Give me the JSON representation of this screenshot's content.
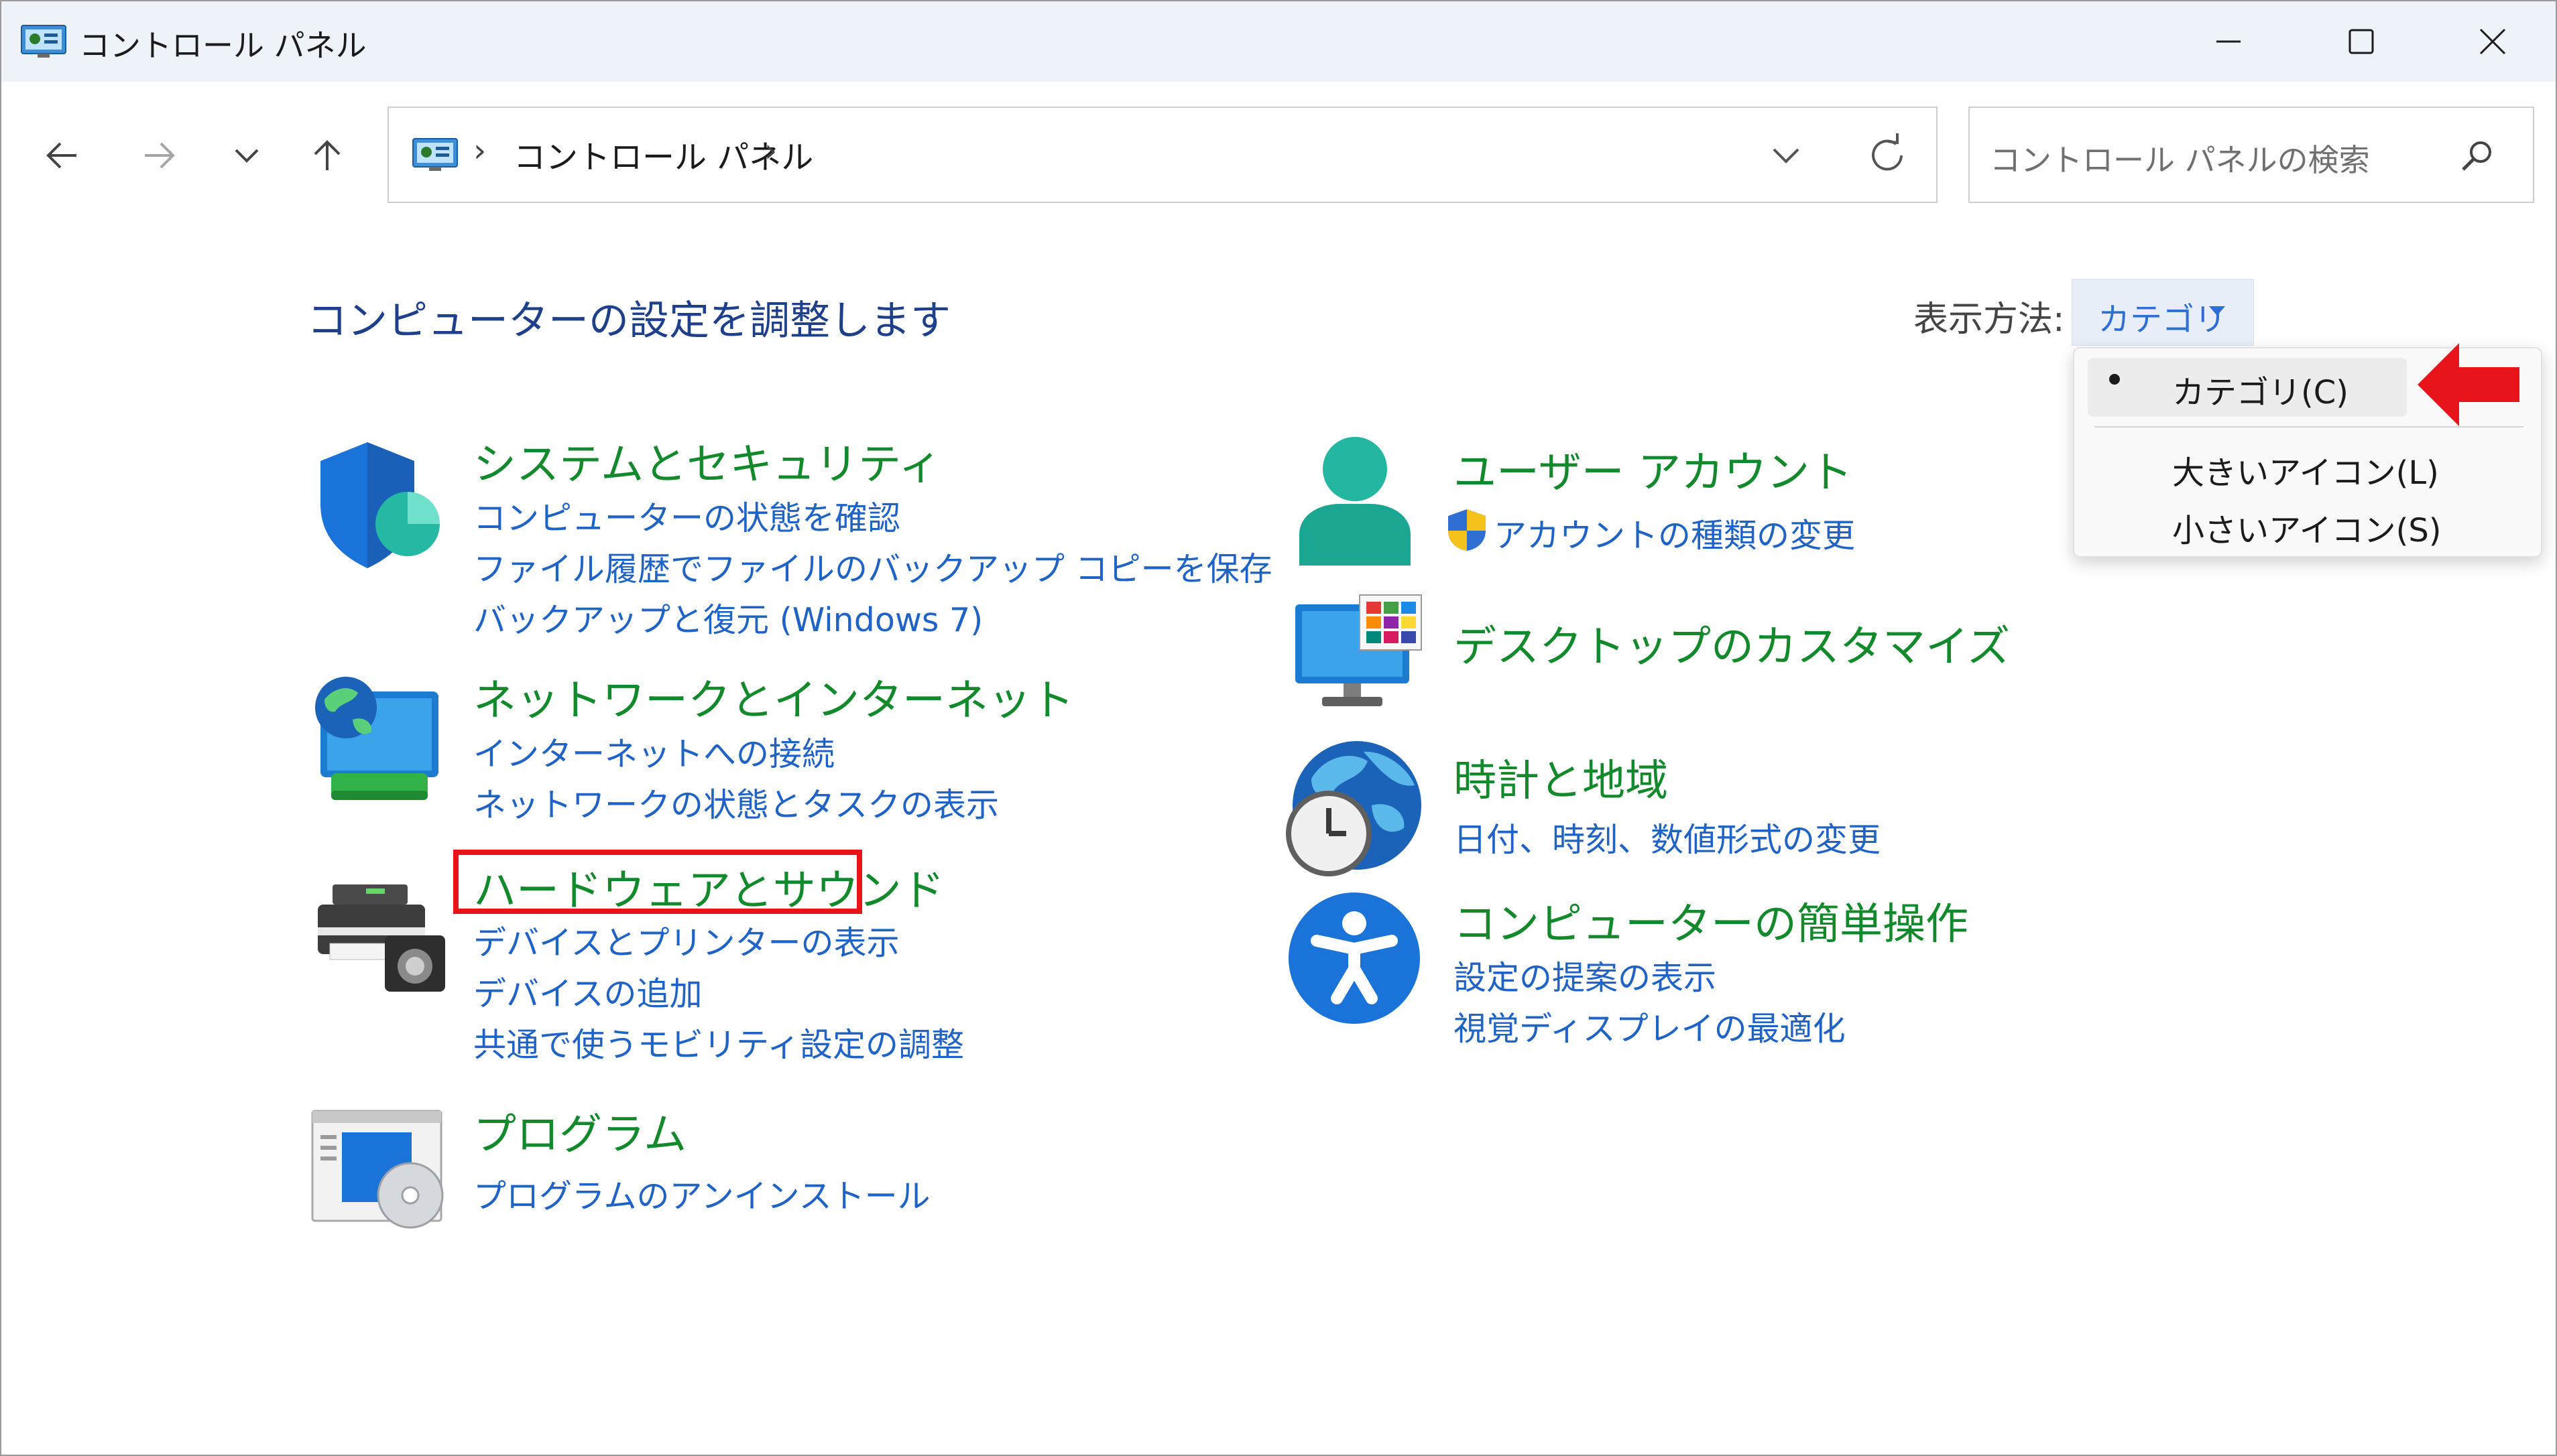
{
  "window": {
    "title": "コントロール パネル"
  },
  "address_bar": {
    "path_label": "コントロール パネル",
    "separator": "›"
  },
  "search": {
    "placeholder": "コントロール パネルの検索"
  },
  "main": {
    "heading": "コンピューターの設定を調整します",
    "view_by_label": "表示方法:",
    "view_by_value": "カテゴリ"
  },
  "categories": {
    "system_security": {
      "title": "システムとセキュリティ",
      "links": [
        "コンピューターの状態を確認",
        "ファイル履歴でファイルのバックアップ コピーを保存",
        "バックアップと復元 (Windows 7)"
      ]
    },
    "network": {
      "title": "ネットワークとインターネット",
      "links": [
        "インターネットへの接続",
        "ネットワークの状態とタスクの表示"
      ]
    },
    "hardware": {
      "title": "ハードウェアとサウンド",
      "links": [
        "デバイスとプリンターの表示",
        "デバイスの追加",
        "共通で使うモビリティ設定の調整"
      ]
    },
    "programs": {
      "title": "プログラム",
      "links": [
        "プログラムのアンインストール"
      ]
    },
    "user_accounts": {
      "title": "ユーザー アカウント",
      "links": [
        "アカウントの種類の変更"
      ]
    },
    "desktop": {
      "title": "デスクトップのカスタマイズ",
      "links": []
    },
    "clock_region": {
      "title": "時計と地域",
      "links": [
        "日付、時刻、数値形式の変更"
      ]
    },
    "ease_of_access": {
      "title": "コンピューターの簡単操作",
      "links": [
        "設定の提案の表示",
        "視覚ディスプレイの最適化"
      ]
    }
  },
  "view_menu": {
    "items": [
      "カテゴリ(C)",
      "大きいアイコン(L)",
      "小さいアイコン(S)"
    ],
    "selected_index": 0
  },
  "annotations": {
    "highlight_color": "#e8141b",
    "arrow_color": "#e8141b"
  },
  "colors": {
    "category_title": "#128a2b",
    "link": "#1f63c7",
    "heading": "#1e3f8a",
    "titlebar_bg": "#eef3fa"
  }
}
